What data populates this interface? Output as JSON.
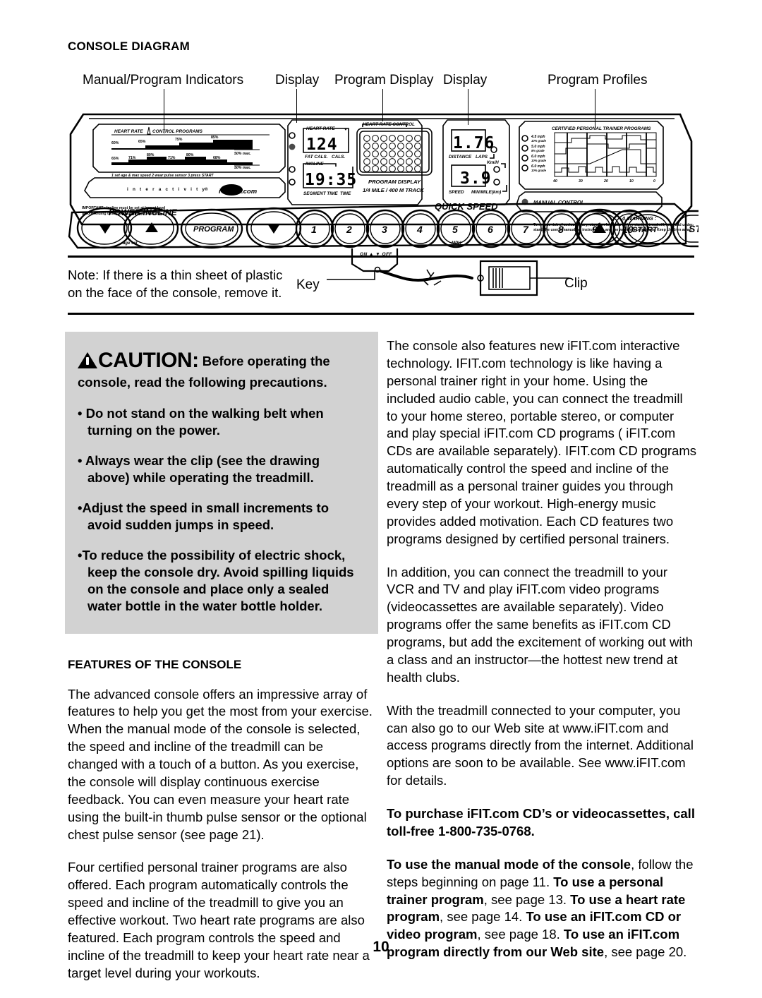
{
  "page": {
    "number": "10"
  },
  "console_diagram": {
    "heading": "CONSOLE DIAGRAM",
    "callouts": [
      {
        "label": "Manual/Program Indicators"
      },
      {
        "label": "Display"
      },
      {
        "label": "Program Display"
      },
      {
        "label": "Display"
      },
      {
        "label": "Program Profiles"
      }
    ],
    "console": {
      "heart_rate_control_programs_label": "HEART RATE  CONTROL PROGRAMS",
      "profile_percent_labels_top": [
        "60%",
        "65%",
        "75%",
        "85%",
        "50% max."
      ],
      "profile_percent_labels_bottom": [
        "65%",
        "71%",
        "80%",
        "71%",
        "80%",
        "68%",
        "50% max."
      ],
      "steps_line": "1 set age & max speed  2 wear pulse sensor  3 press START",
      "interactivity_text": "i n t e r a c t i v i t y",
      "brand": "iFIT.com",
      "important_note": "IMPORTANT : Incline must be set at lowest level before folding treadmill into storage position.",
      "heart_rate_label": "HEART RATE",
      "heart_rate_value": "124",
      "fat_cals_label": "FAT CALS.",
      "cals_label": "CALS.",
      "incline_label": "INCLINE",
      "time_value": "19:35",
      "segment_time_label": "SEGMENT TIME",
      "time_label": "TIME",
      "program_display_top_label": "HEART RATE CONTROL",
      "program_display_label": "PROGRAM DISPLAY",
      "program_display_sub": "1/4 MILE / 400 M TRACK",
      "distance_value": "1.76",
      "distance_label": "DISTANCE",
      "laps_label": "LAPS",
      "kmh_label": "Km/H",
      "speed_value": "3.9",
      "speed_label": "SPEED",
      "min_mile_label": "MIN/MILE(km)",
      "certified_programs_label": "CERTIFIED PERSONAL TRAINER PROGRAMS",
      "program_leds": [
        {
          "speed": "4.5 mph",
          "grade": "10% grade"
        },
        {
          "speed": "5.0 mph",
          "grade": "8% grade"
        },
        {
          "speed": "6.0 mph",
          "grade": "10% grade"
        },
        {
          "speed": "6.0 mph",
          "grade": "10% grade"
        }
      ],
      "profile_axis_labels": [
        "40",
        "30",
        "20",
        "10",
        "0"
      ],
      "manual_control_label": "MANUAL CONTROL",
      "warning_title": "WARNING :",
      "warning_text": "To reduce risk of serious injury, stand on foot rails before starting treadmill, read and understand the user's manual, all instructions, and the warnings before use.  Keep children away.",
      "quick_speed_label": "QUICK SPEED",
      "mph_label": "MPH",
      "age_set_label": "age set",
      "power_incline_label": "POWER INCLINE",
      "buttons": [
        "▼",
        "▲",
        "PROGRAM",
        "▼",
        "1",
        "2",
        "3",
        "4",
        "5",
        "6",
        "7",
        "8",
        "9",
        "10",
        "▲",
        "START",
        "STOP"
      ],
      "on_off_label": "ON ▲      ▼ OFF"
    },
    "note": "Note: If there is a thin sheet of plastic on the face of the console, remove it.",
    "key_label": "Key",
    "clip_label": "Clip"
  },
  "caution": {
    "word": "CAUTION",
    "colon": ":",
    "head_rest": "Before operating the console, read the following precautions.",
    "items": [
      "• Do not stand on the walking belt when turning on the power.",
      "• Always wear the clip (see the drawing above) while operating the treadmill.",
      "•Adjust the speed in small increments to avoid sudden jumps in speed.",
      "•To reduce the possibility of electric shock, keep the console dry. Avoid spilling liquids on the console and place only a sealed water bottle in the water bottle holder."
    ],
    "background": "#d2d2d2"
  },
  "features": {
    "heading": "FEATURES OF THE CONSOLE",
    "paragraphs": [
      "The advanced console offers an impressive array of features to help you get the most from your exercise. When the manual mode of the console is selected, the speed and incline of the treadmill can be changed with a touch of a button. As you exercise, the console will display continuous exercise feedback. You can even measure your heart rate using the built-in thumb pulse sensor or the optional chest pulse sensor (see page 21).",
      "Four certified personal trainer programs are also offered. Each program automatically controls the speed and incline of the treadmill to give you an effective workout. Two heart rate programs are also featured. Each program controls the speed and incline of the treadmill to keep your heart rate near a target level during your workouts."
    ]
  },
  "right_column": {
    "paragraphs": [
      "The console also features new iFIT.com interactive technology. IFIT.com technology is like having a personal trainer right in your home. Using the included audio cable, you can connect the treadmill to your home stereo, portable stereo, or computer and play special iFIT.com CD programs ( iFIT.com CDs are available separately). IFIT.com CD programs automatically control the speed and incline of the treadmill as a personal trainer guides you through every step of your workout. High-energy music provides added motivation. Each CD features two programs designed by certified personal trainers.",
      "In addition, you can connect the treadmill to your VCR and TV and play iFIT.com video programs (videocassettes are available separately). Video programs offer the same benefits as iFIT.com CD programs, but add the excitement of working out with a class and an instructor—the hottest new trend at health clubs.",
      "With the treadmill connected to your computer, you can also go to our Web site at www.iFIT.com and access programs directly from the internet. Additional options are soon to be available. See www.iFIT.com for details."
    ],
    "purchase_note": "To purchase iFIT.com CD’s or videocassettes, call toll-free 1-800-735-0768.",
    "usage_note_parts": {
      "b1": "To use the manual mode of the console",
      "t1": ", follow the steps beginning on page 11. ",
      "b2": "To use a personal trainer program",
      "t2": ", see page 13. ",
      "b3": "To use a heart rate program",
      "t3": ", see page 14. ",
      "b4": "To use an iFIT.com CD or video program",
      "t4": ", see page 18. ",
      "b5": "To use an iFIT.com program directly from our Web site",
      "t5": ", see page 20."
    }
  }
}
